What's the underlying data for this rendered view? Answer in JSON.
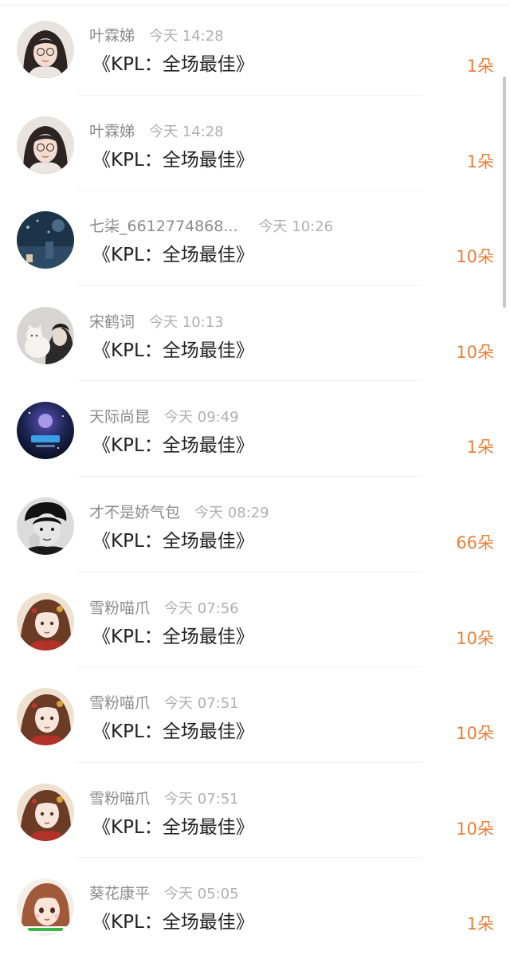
{
  "records": [
    {
      "user": "叶霖娣",
      "time": "今天 14:28",
      "gift": "《KPL：全场最佳》",
      "count": "1朵",
      "avatar": "avatar-girl-glasses"
    },
    {
      "user": "叶霖娣",
      "time": "今天 14:28",
      "gift": "《KPL：全场最佳》",
      "count": "1朵",
      "avatar": "avatar-girl-glasses"
    },
    {
      "user": "七柒_6612774868...",
      "time": "今天 10:26",
      "gift": "《KPL：全场最佳》",
      "count": "10朵",
      "avatar": "avatar-night-scene"
    },
    {
      "user": "宋鹤词",
      "time": "今天 10:13",
      "gift": "《KPL：全场最佳》",
      "count": "10朵",
      "avatar": "avatar-person-with-cat"
    },
    {
      "user": "天际尚昆",
      "time": "今天 09:49",
      "gift": "《KPL：全场最佳》",
      "count": "1朵",
      "avatar": "avatar-galaxy-logo"
    },
    {
      "user": "才不是娇气包",
      "time": "今天 08:29",
      "gift": "《KPL：全场最佳》",
      "count": "66朵",
      "avatar": "avatar-bw-portrait"
    },
    {
      "user": "雪粉喵爪",
      "time": "今天 07:56",
      "gift": "《KPL：全场最佳》",
      "count": "10朵",
      "avatar": "avatar-anime-girl"
    },
    {
      "user": "雪粉喵爪",
      "time": "今天 07:51",
      "gift": "《KPL：全场最佳》",
      "count": "10朵",
      "avatar": "avatar-anime-girl"
    },
    {
      "user": "雪粉喵爪",
      "time": "今天 07:51",
      "gift": "《KPL：全场最佳》",
      "count": "10朵",
      "avatar": "avatar-anime-girl"
    },
    {
      "user": "葵花康平",
      "time": "今天 05:05",
      "gift": "《KPL：全场最佳》",
      "count": "1朵",
      "avatar": "avatar-cartoon-girl"
    }
  ],
  "colors": {
    "count": "#e8803a",
    "username": "#8c8c8c",
    "time": "#b0b0b0",
    "gift_text": "#222222"
  }
}
